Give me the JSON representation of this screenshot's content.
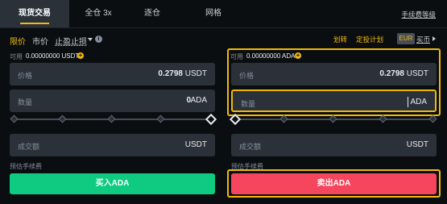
{
  "tabs": [
    {
      "label": "现货交易",
      "active": true
    },
    {
      "label": "全仓 3x",
      "active": false
    },
    {
      "label": "逐仓",
      "active": false
    },
    {
      "label": "网格",
      "active": false
    }
  ],
  "fee_level": "手续费等级",
  "order_types": {
    "limit": "限价",
    "market": "市价",
    "stop_limit": "止盈止损"
  },
  "links": {
    "transfer": "划转",
    "recurring": "定投计划",
    "currency_badge": "EUR",
    "buy_crypto": "买币"
  },
  "buy": {
    "available_label": "可用",
    "available_value": "0.00000000 USDT",
    "price_label": "价格",
    "price_value": "0.2798",
    "price_unit": "USDT",
    "amount_label": "数量",
    "amount_value": "0",
    "amount_unit": "ADA",
    "total_label": "成交额",
    "total_unit": "USDT",
    "fee_label": "预估手续费",
    "button_label": "买入ADA"
  },
  "sell": {
    "available_label": "可用",
    "available_value": "0.00000000 ADA",
    "price_label": "价格",
    "price_value": "0.2798",
    "price_unit": "USDT",
    "amount_label": "数量",
    "amount_unit": "ADA",
    "total_label": "成交额",
    "total_unit": "USDT",
    "fee_label": "预估手续费",
    "button_label": "卖出ADA"
  },
  "colors": {
    "accent": "#f0b90b",
    "buy": "#0ecb81",
    "sell": "#f6465d"
  }
}
